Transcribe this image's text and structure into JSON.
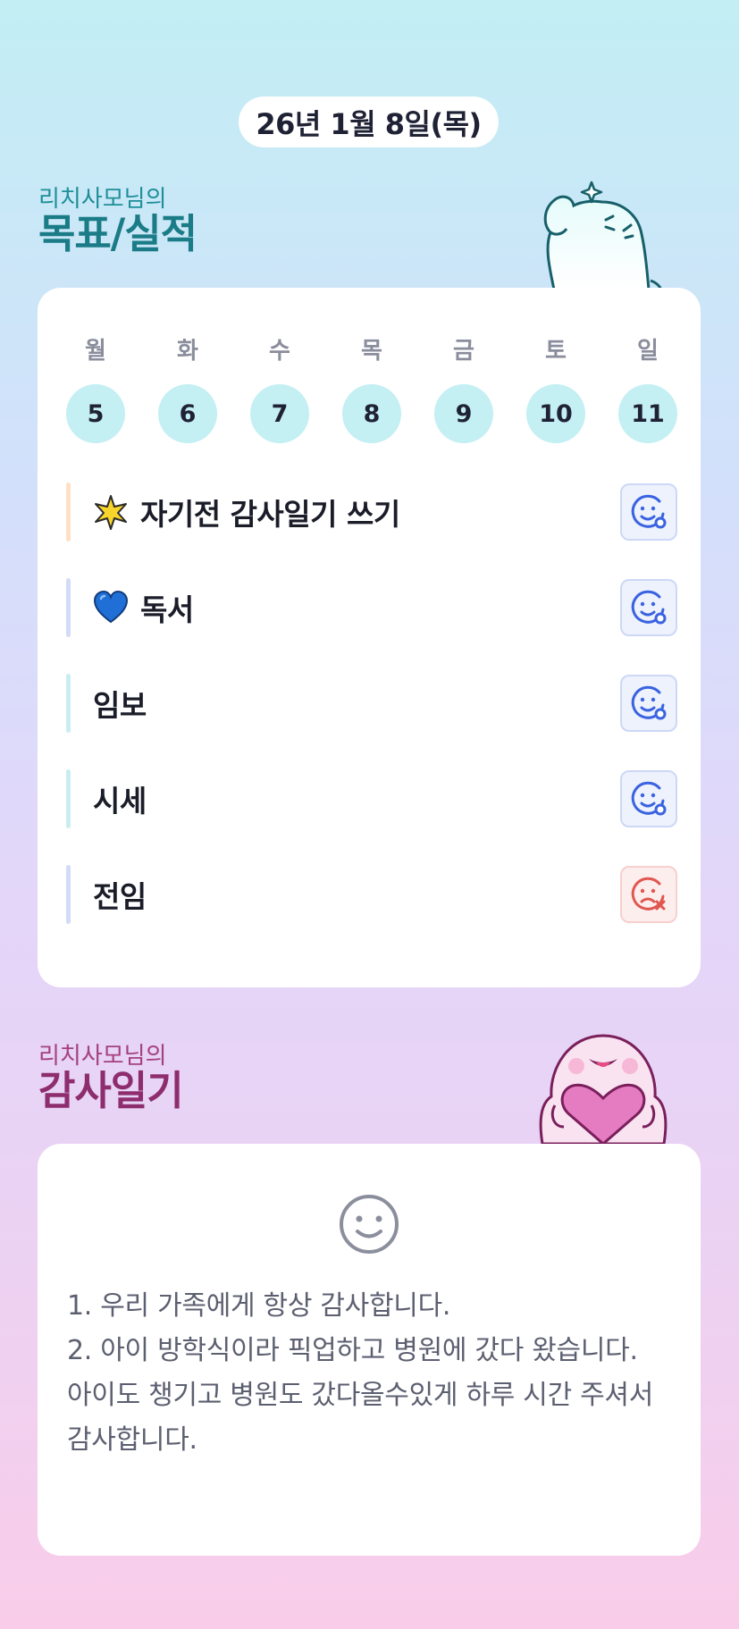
{
  "header": {
    "date": "26년 1월 8일(목)"
  },
  "goals_section": {
    "subtitle": "리치사모님의",
    "title": "목표/실적",
    "week": [
      {
        "day": "월",
        "date": "5"
      },
      {
        "day": "화",
        "date": "6"
      },
      {
        "day": "수",
        "date": "7"
      },
      {
        "day": "목",
        "date": "8"
      },
      {
        "day": "금",
        "date": "9"
      },
      {
        "day": "토",
        "date": "10"
      },
      {
        "day": "일",
        "date": "11"
      }
    ],
    "goals": [
      {
        "label": "자기전 감사일기 쓰기",
        "emoji": "star-icon",
        "bar_color": "#fde0c6",
        "status": "done"
      },
      {
        "label": "독서",
        "emoji": "blue-heart-icon",
        "bar_color": "#d3dcf7",
        "status": "done"
      },
      {
        "label": "임보",
        "emoji": "",
        "bar_color": "#c9eef2",
        "status": "done"
      },
      {
        "label": "시세",
        "emoji": "",
        "bar_color": "#c9eef2",
        "status": "done"
      },
      {
        "label": "전임",
        "emoji": "",
        "bar_color": "#d3dcf7",
        "status": "failed"
      }
    ]
  },
  "gratitude_section": {
    "subtitle": "리치사모님의",
    "title": "감사일기",
    "mood": "smile-face-icon",
    "lines": [
      "1. 우리 가족에게 항상 감사합니다.",
      "2. 아이 방학식이라 픽업하고 병원에 갔다 왔습니다.",
      "아이도 챙기고 병원도 갔다올수있게 하루 시간 주셔서 감사합니다."
    ]
  },
  "colors": {
    "teal_title": "#1b7c87",
    "magenta_title": "#8e2d6e",
    "status_ok": "#3a63e0",
    "status_fail": "#e0574f"
  }
}
